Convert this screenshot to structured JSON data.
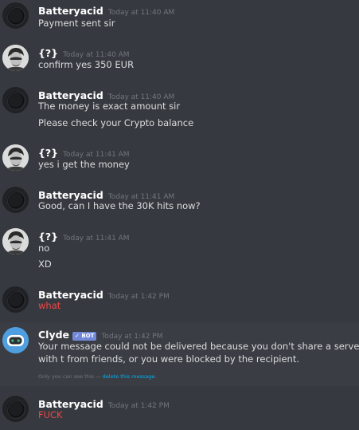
{
  "messages": [
    {
      "username": "Batteryacid",
      "timestamp": "Today at 11:40 AM",
      "avatar": "dark-circle-avatar",
      "lines": [
        {
          "text": "Payment sent sir"
        }
      ]
    },
    {
      "username": "{?}",
      "timestamp": "Today at 11:40 AM",
      "avatar": "face-photo-avatar",
      "lines": [
        {
          "text": "confirm yes 350 EUR"
        }
      ]
    },
    {
      "username": "Batteryacid",
      "timestamp": "Today at 11:40 AM",
      "avatar": "dark-circle-avatar",
      "lines": [
        {
          "text": "The money is exact amount sir"
        },
        {
          "text": "Please check your Crypto balance"
        }
      ]
    },
    {
      "username": "{?}",
      "timestamp": "Today at 11:41 AM",
      "avatar": "face-photo-avatar",
      "lines": [
        {
          "text": "yes i get the money"
        }
      ]
    },
    {
      "username": "Batteryacid",
      "timestamp": "Today at 11:41 AM",
      "avatar": "dark-circle-avatar",
      "lines": [
        {
          "text": "Good, can I have the 30K hits now?"
        }
      ]
    },
    {
      "username": "{?}",
      "timestamp": "Today at 11:41 AM",
      "avatar": "face-photo-avatar",
      "lines": [
        {
          "text": "no"
        },
        {
          "text": "XD"
        }
      ]
    },
    {
      "username": "Batteryacid",
      "timestamp": "Today at 1:42 PM",
      "avatar": "dark-circle-avatar",
      "lines": [
        {
          "text": "what",
          "color": "#f04747"
        }
      ]
    },
    {
      "username": "Clyde",
      "bot_tag": "✓ BOT",
      "timestamp": "Today at 1:42 PM",
      "avatar": "clyde-bot-avatar",
      "lines": [
        {
          "text": "Your message could not be delivered because you don't share a server with t from friends, or you were blocked by the recipient."
        }
      ],
      "ephemeral_note": "Only you can see this — ",
      "ephemeral_link": "delete this message."
    },
    {
      "username": "Batteryacid",
      "timestamp": "Today at 1:42 PM",
      "avatar": "dark-circle-avatar",
      "lines": [
        {
          "text": "FUCK",
          "color": "#f04747"
        }
      ]
    }
  ],
  "colors": {
    "background": "#36393f",
    "username": "#ffffff",
    "message_text": "#dcddde",
    "timestamp": "#72767d",
    "error_red": "#f04747",
    "bot_tag": "#7289da",
    "link": "#00b0f4"
  }
}
